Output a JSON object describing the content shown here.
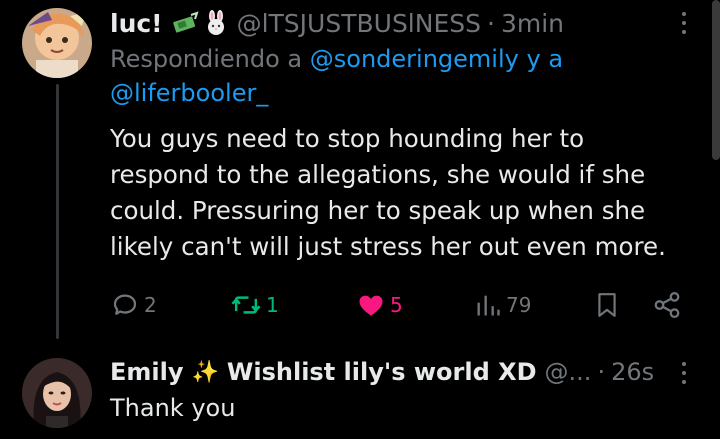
{
  "tweet1": {
    "name": "luc!",
    "handle": "@lTSJUSTBUSlNESS",
    "time": "3min",
    "replying_prefix": "Respondiendo a",
    "mention1": "@sonderingemily",
    "replying_joiner": "y a",
    "mention2": "@liferbooler_",
    "text": "You guys need to stop hounding her to respond to the allegations, she would if she could. Pressuring her to speak up when she likely can't will just stress her out even more.",
    "actions": {
      "replies": "2",
      "reposts": "1",
      "likes": "5",
      "views": "79"
    },
    "colors": {
      "repost": "#00ba7c",
      "like": "#f91880",
      "muted": "#71767b",
      "link": "#1d9bf0"
    },
    "icons": [
      "money-emoji-icon",
      "rabbit-emoji-icon",
      "reply-icon",
      "repost-icon",
      "heart-icon",
      "views-icon",
      "bookmark-icon",
      "share-icon",
      "more-icon"
    ]
  },
  "tweet2": {
    "name": "Emily",
    "sparkle": "✨",
    "name_rest": "Wishlist lily's world XD",
    "handle": "@...",
    "time": "26s",
    "text": "Thank you"
  }
}
